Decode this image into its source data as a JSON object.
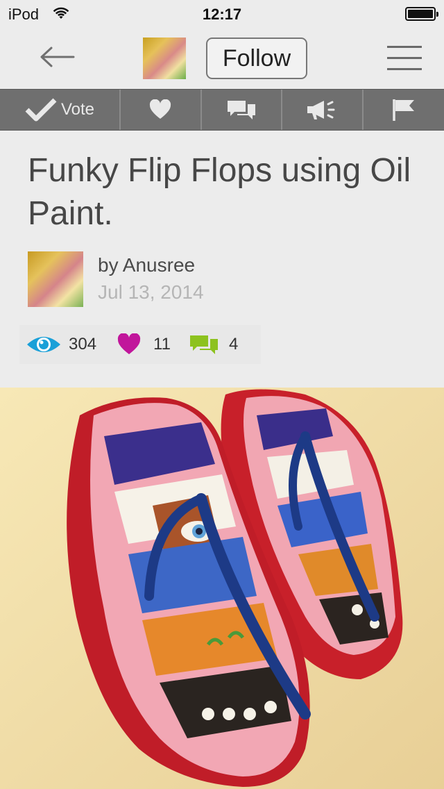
{
  "status_bar": {
    "carrier": "iPod",
    "time": "12:17"
  },
  "nav": {
    "follow_label": "Follow"
  },
  "actions": {
    "vote_label": "Vote"
  },
  "article": {
    "title": "Funky Flip Flops using Oil Paint.",
    "author": "by Anusree",
    "date": "Jul 13, 2014"
  },
  "stats": {
    "views": "304",
    "favorites": "11",
    "comments": "4"
  },
  "icons": {
    "back": "arrow-left-icon",
    "menu": "hamburger-icon",
    "vote": "checkmark-icon",
    "favorite": "heart-icon",
    "comment": "chat-bubbles-icon",
    "share": "megaphone-icon",
    "flag": "flag-icon",
    "views": "eye-icon"
  },
  "colors": {
    "action_bar": "#6f6f6f",
    "views_icon": "#1aa0d8",
    "favorites_icon": "#c1169b",
    "comments_icon": "#8dc21f"
  }
}
